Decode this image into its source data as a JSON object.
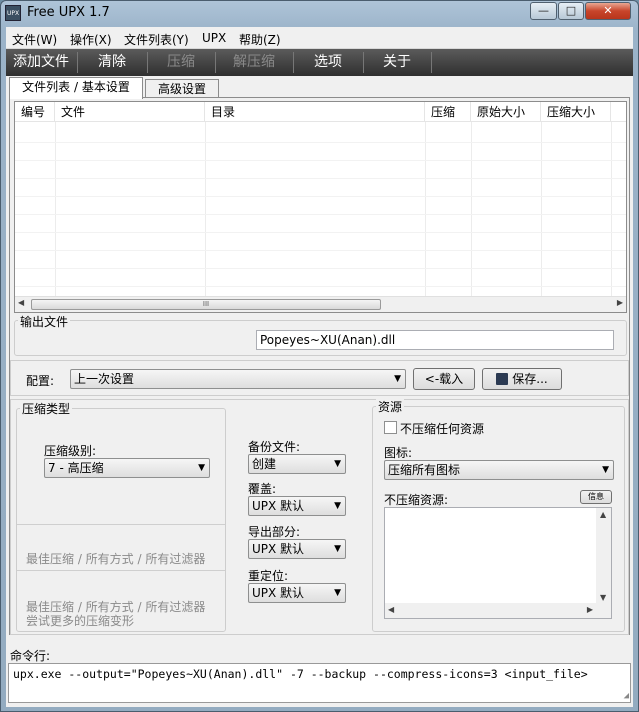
{
  "window": {
    "title": "Free UPX 1.7",
    "icon_text": "UPX",
    "minimize": "—",
    "maximize": "□",
    "close": "✕"
  },
  "menu": [
    "文件(W)",
    "操作(X)",
    "文件列表(Y)",
    "UPX",
    "帮助(Z)"
  ],
  "toolbar": {
    "add_file": "添加文件",
    "clear": "清除",
    "compress": "压缩",
    "decompress": "解压缩",
    "options": "选项",
    "about": "关于"
  },
  "tabs": [
    "文件列表 / 基本设置",
    "高级设置"
  ],
  "file_list": {
    "columns": [
      "编号",
      "文件",
      "目录",
      "压缩",
      "原始大小",
      "压缩大小"
    ],
    "rows": [],
    "scroll_thumb": "III"
  },
  "output": {
    "label": "输出文件",
    "value": "Popeyes~XU(Anan).dll"
  },
  "config": {
    "label": "配置:",
    "selected": "上一次设置",
    "load_button": "<-载入",
    "save_button": "保存..."
  },
  "compression": {
    "group_label": "压缩类型",
    "level_label": "压缩级别:",
    "level_value": "7 - 高压缩",
    "best_option": "最佳压缩 / 所有方式 / 所有过滤器",
    "ultra_option_line1": "最佳压缩 / 所有方式 / 所有过滤器",
    "ultra_option_line2": "尝试更多的压缩变形"
  },
  "middle": {
    "backup_label": "备份文件:",
    "backup_value": "创建",
    "overwrite_label": "覆盖:",
    "overwrite_value": "UPX 默认",
    "exports_label": "导出部分:",
    "exports_value": "UPX 默认",
    "relocs_label": "重定位:",
    "relocs_value": "UPX 默认"
  },
  "resources": {
    "group_label": "资源",
    "no_compress_label": "不压缩任何资源",
    "no_compress_checked": false,
    "icons_label": "图标:",
    "icons_value": "压缩所有图标",
    "keep_label": "不压缩资源:",
    "info_button": "信息"
  },
  "command": {
    "label": "命令行:",
    "value": "upx.exe --output=\"Popeyes~XU(Anan).dll\" -7 --backup --compress-icons=3 <input_file>"
  }
}
